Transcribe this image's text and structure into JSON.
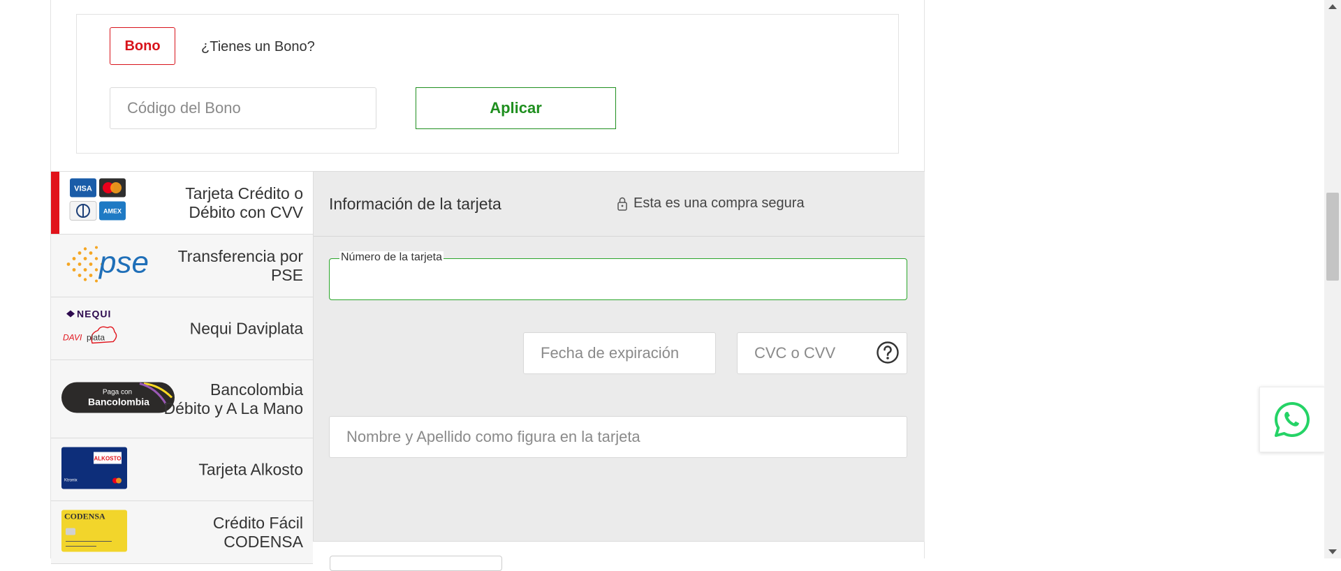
{
  "bono": {
    "tag_label": "Bono",
    "question": "¿Tienes un Bono?",
    "code_placeholder": "Código del Bono",
    "code_value": "",
    "apply_label": "Aplicar"
  },
  "payment_methods": [
    {
      "label": "Tarjeta Crédito o Débito con CVV",
      "icon": "credit-cards-icon",
      "active": true
    },
    {
      "label": "Transferencia por PSE",
      "icon": "pse-logo",
      "active": false
    },
    {
      "label": "Nequi Daviplata",
      "icon": "nequi-daviplata-logo",
      "active": false
    },
    {
      "label": "Bancolombia Débito y A La Mano",
      "icon": "bancolombia-logo",
      "active": false
    },
    {
      "label": "Tarjeta Alkosto",
      "icon": "alkosto-card-icon",
      "active": false
    },
    {
      "label": "Crédito Fácil CODENSA",
      "icon": "codensa-card-icon",
      "active": false
    }
  ],
  "logo_text": {
    "visa": "VISA",
    "amex": "AMEX",
    "pse": "pse",
    "nequi": "NEQUI",
    "davi": "DAVI",
    "plata": "plata",
    "paga_con": "Paga con",
    "bancolombia": "Bancolombia",
    "alkosto": "ALKOSTO",
    "alkosto_sub": "Ktronix",
    "codensa": "CODENSA"
  },
  "card_form": {
    "title": "Información de la tarjeta",
    "secure_text": "Esta es una compra segura",
    "number_label": "Número de la tarjeta",
    "number_value": "",
    "expiry_placeholder": "Fecha de expiración",
    "cvv_placeholder": "CVC o CVV",
    "holder_placeholder": "Nombre y Apellido como figura en la tarjeta"
  },
  "colors": {
    "brand_red": "#e1131b",
    "accent_green": "#1f8f1f",
    "whatsapp_green": "#25d366"
  },
  "floating": {
    "whatsapp_icon": "whatsapp-icon"
  }
}
